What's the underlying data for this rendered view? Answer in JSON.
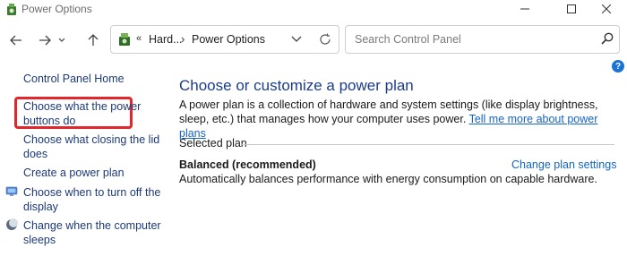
{
  "window": {
    "title": "Power Options"
  },
  "nav": {
    "breadcrumb_prefix": "«",
    "breadcrumb_parent": "Hard...",
    "breadcrumb_sep": "›",
    "breadcrumb_current": "Power Options",
    "search_placeholder": "Search Control Panel"
  },
  "sidebar": {
    "home": "Control Panel Home",
    "items": [
      {
        "label_line1": "Choose what the power",
        "label_line2": "buttons do",
        "icon": null,
        "highlighted": true
      },
      {
        "label_line1": "Choose what closing the lid",
        "label_line2": "does",
        "icon": null
      },
      {
        "label_line1": "Create a power plan",
        "label_line2": "",
        "icon": null
      },
      {
        "label_line1": "Choose when to turn off the",
        "label_line2": "display",
        "icon": "monitor-icon"
      },
      {
        "label_line1": "Change when the computer",
        "label_line2": "sleeps",
        "icon": "moon-icon"
      }
    ]
  },
  "main": {
    "title": "Choose or customize a power plan",
    "description": "A power plan is a collection of hardware and system settings (like display brightness, sleep, etc.) that manages how your computer uses power.",
    "description_link": "Tell me more about power plans",
    "selected_label": "Selected plan",
    "plan_name": "Balanced (recommended)",
    "plan_change": "Change plan settings",
    "plan_description": "Automatically balances performance with energy consumption on capable hardware."
  },
  "colors": {
    "highlight": "#e3262b",
    "link": "#1565c0",
    "title": "#1a3c8c"
  }
}
